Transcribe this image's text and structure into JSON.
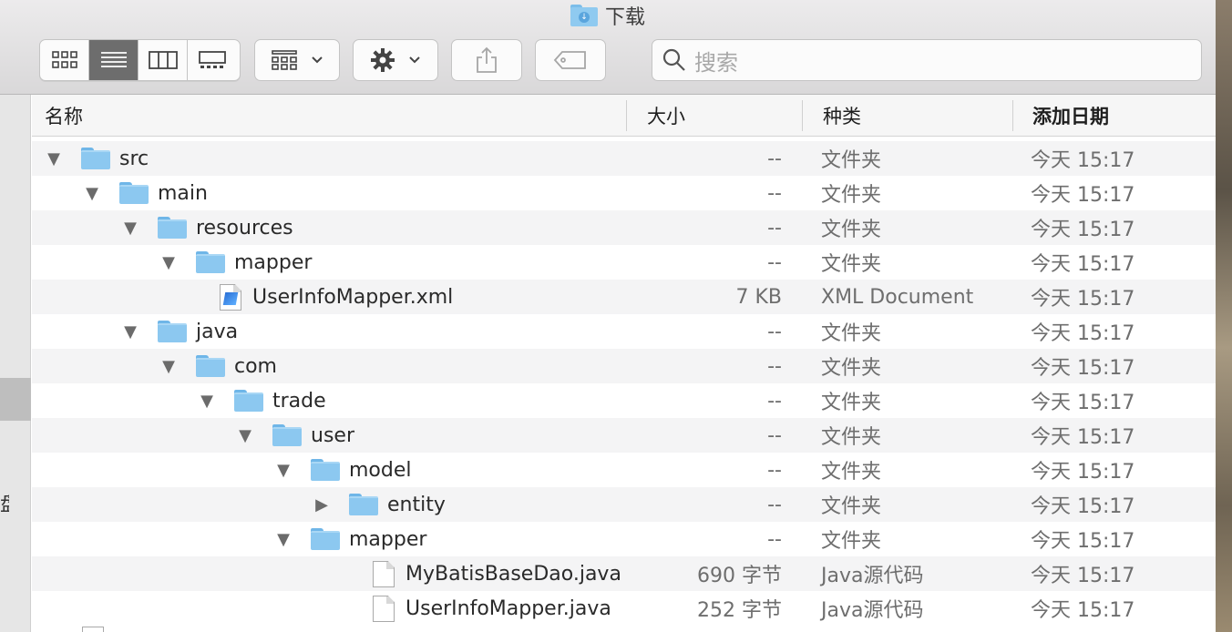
{
  "window": {
    "title": "下载"
  },
  "toolbar": {
    "views": [
      {
        "name": "icon-view",
        "icon": "icon-grid-icon",
        "active": false
      },
      {
        "name": "list-view",
        "icon": "list-icon",
        "active": true
      },
      {
        "name": "column-view",
        "icon": "columns-icon",
        "active": false
      },
      {
        "name": "gallery-view",
        "icon": "gallery-icon",
        "active": false
      }
    ],
    "search": {
      "placeholder": "搜索"
    }
  },
  "columns": {
    "name": "名称",
    "size": "大小",
    "kind": "种类",
    "date_added": "添加日期"
  },
  "sidebar": {
    "partial_label": "盘"
  },
  "rows": [
    {
      "name": "src",
      "type": "folder",
      "level": 0,
      "expanded": true,
      "size": "--",
      "kind": "文件夹",
      "date": "今天 15:17"
    },
    {
      "name": "main",
      "type": "folder",
      "level": 1,
      "expanded": true,
      "size": "--",
      "kind": "文件夹",
      "date": "今天 15:17"
    },
    {
      "name": "resources",
      "type": "folder",
      "level": 2,
      "expanded": true,
      "size": "--",
      "kind": "文件夹",
      "date": "今天 15:17"
    },
    {
      "name": "mapper",
      "type": "folder",
      "level": 3,
      "expanded": true,
      "size": "--",
      "kind": "文件夹",
      "date": "今天 15:17"
    },
    {
      "name": "UserInfoMapper.xml",
      "type": "xml",
      "level": 4,
      "expanded": null,
      "size": "7 KB",
      "kind": "XML Document",
      "date": "今天 15:17"
    },
    {
      "name": "java",
      "type": "folder",
      "level": 2,
      "expanded": true,
      "size": "--",
      "kind": "文件夹",
      "date": "今天 15:17"
    },
    {
      "name": "com",
      "type": "folder",
      "level": 3,
      "expanded": true,
      "size": "--",
      "kind": "文件夹",
      "date": "今天 15:17"
    },
    {
      "name": "trade",
      "type": "folder",
      "level": 4,
      "expanded": true,
      "size": "--",
      "kind": "文件夹",
      "date": "今天 15:17"
    },
    {
      "name": "user",
      "type": "folder",
      "level": 5,
      "expanded": true,
      "size": "--",
      "kind": "文件夹",
      "date": "今天 15:17"
    },
    {
      "name": "model",
      "type": "folder",
      "level": 6,
      "expanded": true,
      "size": "--",
      "kind": "文件夹",
      "date": "今天 15:17"
    },
    {
      "name": "entity",
      "type": "folder",
      "level": 7,
      "expanded": false,
      "size": "--",
      "kind": "文件夹",
      "date": "今天 15:17"
    },
    {
      "name": "mapper",
      "type": "folder",
      "level": 6,
      "expanded": true,
      "size": "--",
      "kind": "文件夹",
      "date": "今天 15:17"
    },
    {
      "name": "MyBatisBaseDao.java",
      "type": "file",
      "level": 8,
      "expanded": null,
      "size": "690 字节",
      "kind": "Java源代码",
      "date": "今天 15:17"
    },
    {
      "name": "UserInfoMapper.java",
      "type": "file",
      "level": 8,
      "expanded": null,
      "size": "252 字节",
      "kind": "Java源代码",
      "date": "今天 15:17"
    }
  ]
}
